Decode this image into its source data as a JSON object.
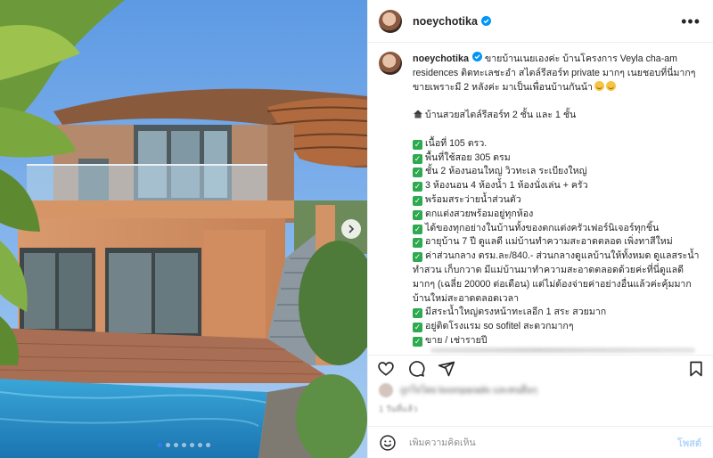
{
  "post": {
    "username": "noeychotika",
    "verified": true,
    "more_label": "•••",
    "caption_lines": [
      {
        "type": "text",
        "text": "ขายบ้านเนยเองค่ะ บ้านโครงการ Veyla cha-am"
      },
      {
        "type": "text",
        "text": "residences ติดทะเลชะอำ สไตล์รีสอร์ท private มากๆ เนยชอบที่นี่มากๆ"
      },
      {
        "type": "emoji",
        "text": "ขายเพราะมี 2 หลังค่ะ มาเป็นเพื่อนบ้านกันน้า"
      },
      {
        "type": "blank",
        "text": ""
      },
      {
        "type": "house",
        "text": "บ้านสวยสไตล์รีสอร์ท 2 ชั้น และ 1 ชั้น"
      },
      {
        "type": "blank",
        "text": ""
      },
      {
        "type": "check",
        "text": "เนื้อที่ 105 ตรว."
      },
      {
        "type": "check",
        "text": "พื้นที่ใช้สอย 305 ตรม"
      },
      {
        "type": "check",
        "text": "ชั้น 2 ห้องนอนใหญ่ วิวทะเล ระเบียงใหญ่"
      },
      {
        "type": "check",
        "text": "3 ห้องนอน 4 ห้องน้ำ 1 ห้องนั่งเล่น + ครัว"
      },
      {
        "type": "check",
        "text": "พร้อมสระว่ายน้ำส่วนตัว"
      },
      {
        "type": "check",
        "text": "ตกแต่งสวยพร้อมอยู่ทุกห้อง"
      },
      {
        "type": "check",
        "text": "ได้ของทุกอย่างในบ้านทั้งของตกแต่งครัวเฟอร์นิเจอร์ทุกชิ้น"
      },
      {
        "type": "check",
        "text": "อายุบ้าน 7 ปี ดูแลดี แม่บ้านทำความสะอาดตลอด เพิ่งทาสีใหม่"
      },
      {
        "type": "check",
        "text": "ค่าส่วนกลาง ตรม.ละ/840.- ส่วนกลางดูแลบ้านให้ทั้งหมด ดูแลสระน้ำ"
      },
      {
        "type": "text",
        "text": "ทำสวน เก็บกวาด มีแม่บ้านมาทำความสะอาดตลอดด้วยค่ะที่นี่ดูแลดี"
      },
      {
        "type": "text",
        "text": "มากๆ (เฉลี่ย 20000 ต่อเดือน) แต่ไม่ต้องจ่ายค่าอย่างอื่นแล้วค่ะคุ้มมาก"
      },
      {
        "type": "text",
        "text": "บ้านใหม่สะอาดตลอดเวลา"
      },
      {
        "type": "check",
        "text": "มีสระน้ำใหญ่ตรงหน้าทะเลอีก 1 สระ สวยมาก"
      },
      {
        "type": "check",
        "text": "อยู่ติดโรงแรม so sofitel สะดวกมากๆ"
      },
      {
        "type": "check",
        "text": "ขาย / เช่ารายปี"
      }
    ]
  },
  "liked_by": "ถูกใจโดย boomparadis และคนอื่นๆ",
  "date": "1 วันที่แล้ว",
  "comment": {
    "placeholder": "เพิ่มความคิดเห็น",
    "post_label": "โพสต์"
  },
  "carousel": {
    "count": 7,
    "active": 0
  },
  "icons": {
    "verified": "verified-badge-icon",
    "more": "more-options-icon",
    "like": "heart-icon",
    "comment": "comment-bubble-icon",
    "share": "paper-plane-icon",
    "save": "bookmark-icon",
    "emoji": "smiley-icon",
    "next": "chevron-right-icon",
    "check": "check-mark-icon",
    "house": "house-icon"
  },
  "colors": {
    "verified": "#0095f6",
    "check": "#2da94f",
    "post_disabled": "#b3d6fb"
  }
}
